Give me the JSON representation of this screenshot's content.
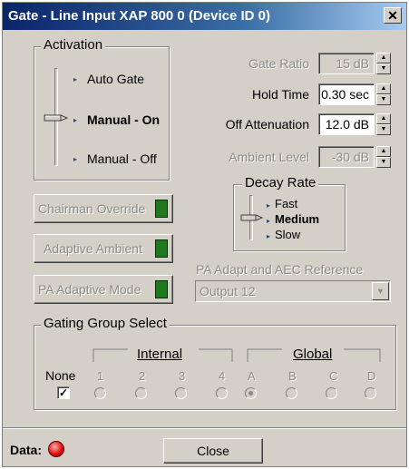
{
  "window": {
    "title": "Gate - Line Input  XAP 800 0 (Device ID 0)"
  },
  "activation": {
    "label": "Activation",
    "options": [
      "Auto Gate",
      "Manual - On",
      "Manual - Off"
    ]
  },
  "params": {
    "gate_ratio": {
      "label": "Gate Ratio",
      "value": "15 dB"
    },
    "hold_time": {
      "label": "Hold Time",
      "value": "0.30 sec"
    },
    "off_attenuation": {
      "label": "Off Attenuation",
      "value": "12.0 dB"
    },
    "ambient_level": {
      "label": "Ambient Level",
      "value": "-30 dB"
    }
  },
  "decay_rate": {
    "label": "Decay Rate",
    "options": [
      "Fast",
      "Medium",
      "Slow"
    ]
  },
  "buttons": {
    "chairman_override": "Chairman Override",
    "adaptive_ambient": "Adaptive Ambient",
    "pa_adaptive_mode": "PA Adaptive Mode"
  },
  "pa_ref": {
    "label": "PA Adapt and AEC Reference",
    "value": "Output 12"
  },
  "gating": {
    "label": "Gating Group Select",
    "internal_label": "Internal",
    "global_label": "Global",
    "none_label": "None",
    "columns": [
      "1",
      "2",
      "3",
      "4",
      "A",
      "B",
      "C",
      "D"
    ]
  },
  "footer": {
    "data_label": "Data:",
    "close_label": "Close"
  },
  "colors": {
    "face": "#d4d0c8",
    "led_green": "#1f7a1f",
    "data_led": "#e01010",
    "title_bar": "#0a246a"
  }
}
